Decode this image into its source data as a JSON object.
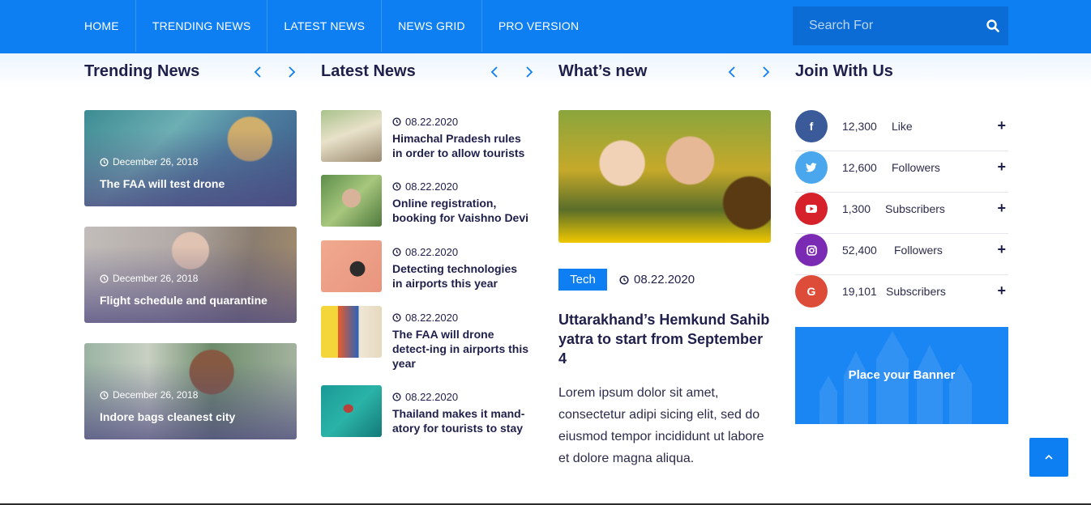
{
  "nav": {
    "items": [
      "HOME",
      "TRENDING NEWS",
      "LATEST NEWS",
      "NEWS GRID",
      "PRO VERSION"
    ],
    "search_placeholder": "Search For",
    "accent": "#0d7ff2"
  },
  "trending": {
    "title": "Trending News",
    "cards": [
      {
        "date": "December 26, 2018",
        "title": "The FAA will test drone"
      },
      {
        "date": "December 26, 2018",
        "title": "Flight schedule and quarantine"
      },
      {
        "date": "December 26, 2018",
        "title": "Indore bags cleanest city"
      }
    ]
  },
  "latest": {
    "title": "Latest News",
    "items": [
      {
        "date": "08.22.2020",
        "title": "Himachal Pradesh rules in order to allow tourists"
      },
      {
        "date": "08.22.2020",
        "title": "Online registration, booking for Vaishno Devi"
      },
      {
        "date": "08.22.2020",
        "title": "Detecting technologies in airports this year"
      },
      {
        "date": "08.22.2020",
        "title": "The FAA will drone detect-ing in airports this year"
      },
      {
        "date": "08.22.2020",
        "title": "Thailand makes it mand-atory for tourists to stay"
      }
    ]
  },
  "whats_new": {
    "title": "What’s new",
    "tag": "Tech",
    "date": "08.22.2020",
    "headline": "Uttarakhand’s Hemkund Sahib yatra to start from September 4",
    "body": "Lorem ipsum dolor sit amet, consectetur adipi sicing elit, sed do eiusmod tempor incididunt ut labore et dolore magna aliqua."
  },
  "join": {
    "title": "Join With Us",
    "socials": [
      {
        "icon": "facebook-icon",
        "count": "12,300",
        "label": "Like",
        "color": "#3b5a9a"
      },
      {
        "icon": "twitter-icon",
        "count": "12,600",
        "label": "Followers",
        "color": "#4aa7ee"
      },
      {
        "icon": "youtube-icon",
        "count": "1,300",
        "label": "Subscribers",
        "color": "#d6202a"
      },
      {
        "icon": "instagram-icon",
        "count": "52,400",
        "label": "Followers",
        "color": "#7b2bb3"
      },
      {
        "icon": "google-plus-icon",
        "count": "19,101",
        "label": "Subscribers",
        "color": "#dd4b39"
      }
    ],
    "banner_text": "Place your Banner"
  }
}
